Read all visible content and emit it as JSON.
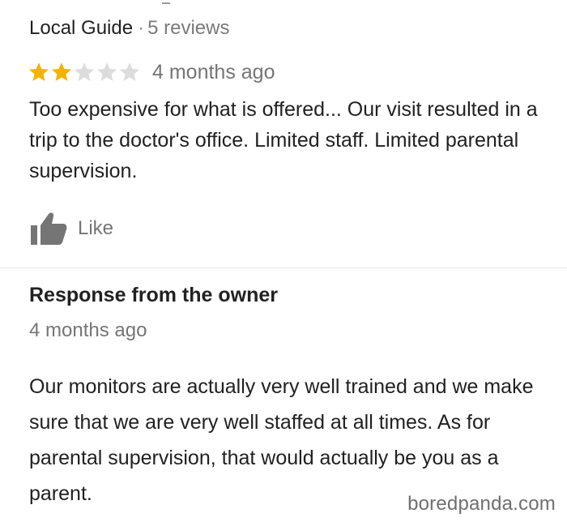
{
  "review": {
    "reviewer_badge": "Local Guide",
    "separator": "·",
    "review_count": "5 reviews",
    "rating": 2,
    "rating_max": 5,
    "star_color_on": "#f2b400",
    "star_color_off": "#dcdcdc",
    "time_ago": "4 months ago",
    "text": "Too expensive for what is offered... Our visit resulted in a trip to the doctor's office. Limited staff. Limited parental supervision.",
    "like_icon": "thumbs-up-icon",
    "like_label": "Like"
  },
  "owner_response": {
    "title": "Response from the owner",
    "time_ago": "4 months ago",
    "text": "Our monitors are actually very well trained and we make sure that we are very well staffed at all times. As for parental supervision, that would actually be you as a parent."
  },
  "watermark": {
    "text": "boredpanda.com"
  }
}
